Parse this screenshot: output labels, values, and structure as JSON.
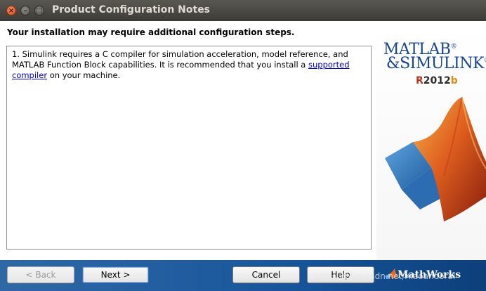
{
  "window": {
    "title": "Product Configuration Notes",
    "close_glyph": "×",
    "minimize_glyph": "–",
    "maximize_glyph": "□"
  },
  "main": {
    "heading": "Your installation may require additional configuration steps.",
    "note_1_text_before": "1. Simulink requires a C compiler for simulation acceleration, model reference, and MATLAB Function Block capabilities. It is recommended that you install a ",
    "note_1_link": "supported compiler",
    "note_1_text_after": " on your machine."
  },
  "brand": {
    "matlab": "MATLAB",
    "simulink": "&SIMULINK",
    "registered_mark": "®",
    "release_r": "R",
    "release_year": "2012",
    "release_b": "b"
  },
  "footer": {
    "back_label": "< Back",
    "next_label": "Next >",
    "cancel_label": "Cancel",
    "help_label": "Help",
    "vendor": "MathWorks",
    "watermark": "https://blog.csdn.net/Xiaoandoral"
  },
  "colors": {
    "link": "#0000cc",
    "brand_blue": "#17468d",
    "footer_blue": "#17559b"
  },
  "icons": [
    "close-icon",
    "minimize-icon",
    "maximize-icon",
    "matlab-membrane-logo",
    "mathworks-logo-icon"
  ]
}
